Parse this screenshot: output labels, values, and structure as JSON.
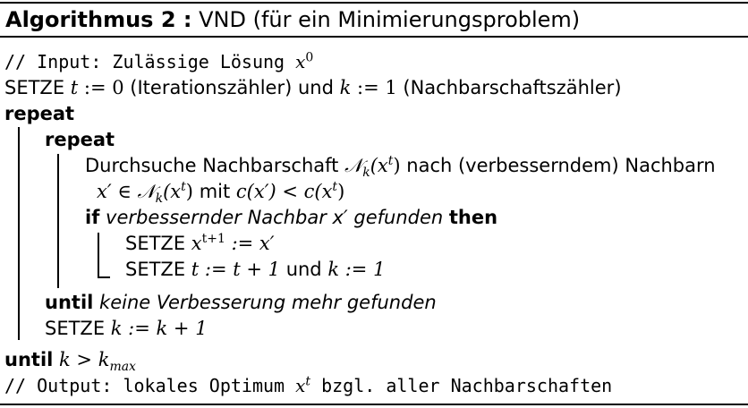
{
  "title": {
    "label": "Algorithmus 2 :",
    "text": "VND (für ein Minimierungsproblem)"
  },
  "lines": {
    "input_comment": "// Input: Zulässige Lösung",
    "input_var": "x",
    "input_sup": "0",
    "setze1_kw": "SETZE",
    "setze1_t": "t",
    "setze1_assign1": " := 0 ",
    "setze1_text1": "(Iterationszähler) und",
    "setze1_k": "k",
    "setze1_assign2": " := 1 ",
    "setze1_text2": "(Nachbarschaftszähler)",
    "repeat_outer": "repeat",
    "repeat_inner": "repeat",
    "search_text1": "Durchsuche Nachbarschaft",
    "search_N": "𝒩",
    "search_k": "k",
    "search_x": "(x",
    "search_t": "t",
    "search_close": ")",
    "search_text2": "nach (verbesserndem) Nachbarn",
    "cond_x": "x′ ∈ 𝒩",
    "cond_k": "k",
    "cond_xt": "(x",
    "cond_t": "t",
    "cond_close": ")",
    "cond_mit": "mit",
    "cond_expr": "c(x′) < c(x",
    "cond_t2": "t",
    "cond_close2": ")",
    "if_kw": "if",
    "if_text": "verbessernder Nachbar x′ gefunden",
    "then_kw": "then",
    "setze2_kw": "SETZE",
    "setze2_x": "x",
    "setze2_sup": "t+1",
    "setze2_rest": " := x′",
    "setze3_kw": "SETZE",
    "setze3_expr1": "t := t + 1",
    "setze3_und": "und",
    "setze3_expr2": "k := 1",
    "until_inner_kw": "until",
    "until_inner_text": "keine Verbesserung mehr gefunden",
    "setze4_kw": "SETZE",
    "setze4_expr": "k := k + 1",
    "until_outer_kw": "until",
    "until_outer_k": "k > k",
    "until_outer_sub": "max",
    "output_comment": "// Output: lokales Optimum",
    "output_x": "x",
    "output_sup": "t",
    "output_text": "bzgl. aller Nachbarschaften"
  }
}
